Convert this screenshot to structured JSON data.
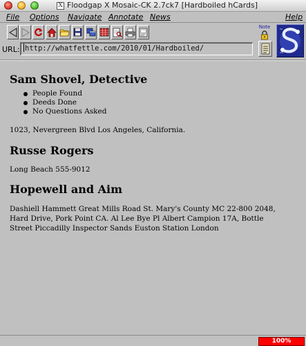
{
  "window": {
    "title": "Floodgap X Mosaic-CK 2.7ck7 [Hardboiled hCards]",
    "x_badge": "X"
  },
  "menu": {
    "file": "File",
    "options": "Options",
    "navigate": "Navigate",
    "annotate": "Annotate",
    "news": "News",
    "help": "Help"
  },
  "toolbar": {
    "note_label": "Note"
  },
  "url": {
    "label": "URL:",
    "value": "http://whatfettle.com/2010/01/Hardboiled/"
  },
  "content": {
    "heading1": "Sam Shovel, Detective",
    "bullets": [
      "People Found",
      "Deeds Done",
      "No Questions Asked"
    ],
    "address1": "1023, Nevergreen Blvd Los Angeles, California.",
    "heading2": "Russe Rogers",
    "address2": "Long Beach 555-9012",
    "heading3": "Hopewell and Aim",
    "address3": "Dashiell Hammett Great Mills Road St. Mary's County MC 22-800 2048, Hard Drive, Pork Point CA. Al Lee Bye Pl Albert Campion 17A, Bottle Street Piccadilly Inspector Sands Euston Station London"
  },
  "status": {
    "progress": "100%",
    "progress_color": "#ff0000"
  }
}
